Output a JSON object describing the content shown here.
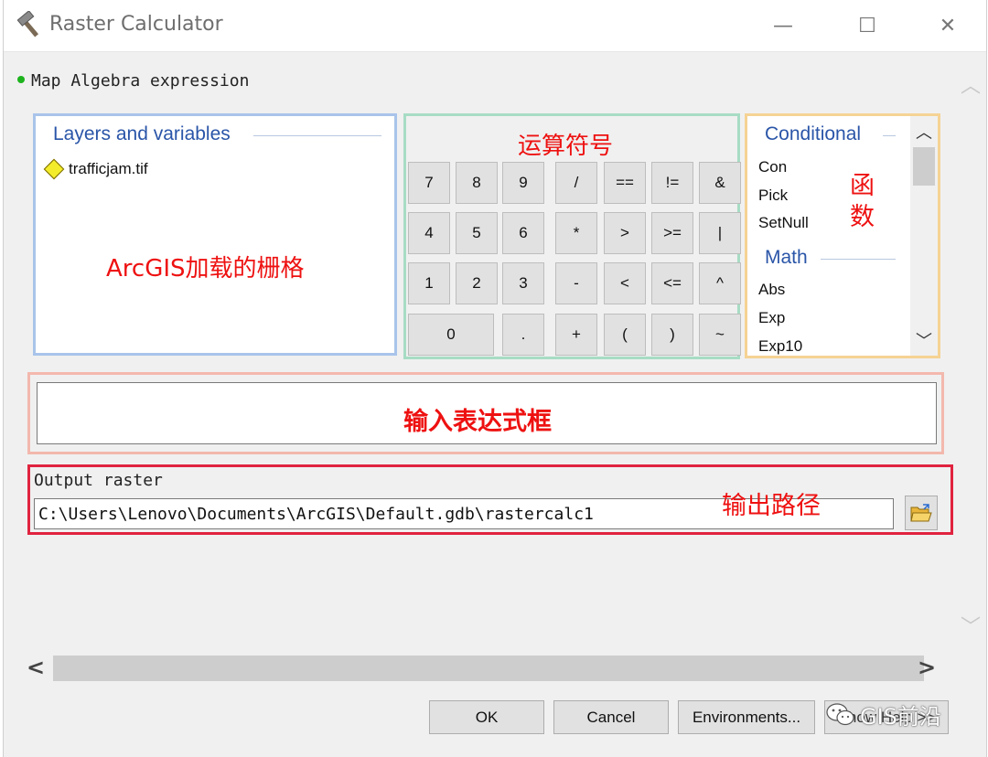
{
  "window": {
    "title": "Raster Calculator",
    "min_symbol": "—",
    "max_symbol": "☐",
    "close_symbol": "✕"
  },
  "section_label": "Map Algebra expression",
  "layers_panel": {
    "title": "Layers and variables",
    "items": [
      "trafficjam.tif"
    ],
    "annotation": "ArcGIS加载的栅格"
  },
  "operators_panel": {
    "annotation": "运算符号",
    "keys": [
      [
        "7",
        "8",
        "9",
        "/",
        "==",
        "!=",
        "&"
      ],
      [
        "4",
        "5",
        "6",
        "*",
        ">",
        ">=",
        "|"
      ],
      [
        "1",
        "2",
        "3",
        "-",
        "<",
        "<=",
        "^"
      ],
      [
        "0",
        ".",
        "+",
        "(",
        ")",
        "~"
      ]
    ]
  },
  "functions_panel": {
    "annotation": "函数",
    "groups": [
      {
        "title": "Conditional",
        "items": [
          "Con",
          "Pick",
          "SetNull"
        ]
      },
      {
        "title": "Math",
        "items": [
          "Abs",
          "Exp",
          "Exp10"
        ]
      }
    ]
  },
  "expression_box": {
    "value": "",
    "annotation": "输入表达式框"
  },
  "output": {
    "label": "Output raster",
    "value": "C:\\Users\\Lenovo\\Documents\\ArcGIS\\Default.gdb\\rastercalc1",
    "annotation": "输出路径"
  },
  "buttons": {
    "ok": "OK",
    "cancel": "Cancel",
    "environments": "Environments...",
    "show_help": "Show Help >>"
  },
  "watermark": "GIS前沿"
}
